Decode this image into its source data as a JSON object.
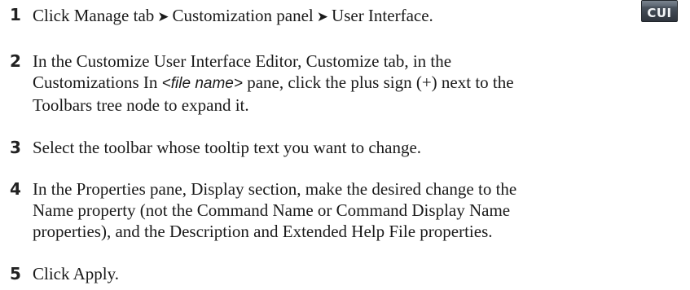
{
  "icon": {
    "name": "cui-icon",
    "label": "CUI"
  },
  "steps": [
    {
      "number": "1",
      "text_parts": [
        "Click Manage tab",
        "Customization panel",
        "User Interface."
      ],
      "arrow": "➤"
    },
    {
      "number": "2",
      "lines": [
        "In the Customize User Interface Editor, Customize tab, in the",
        "Customizations In ",
        "<file name>",
        " pane, click the plus sign (+) next to the",
        "Toolbars tree node to expand it."
      ]
    },
    {
      "number": "3",
      "text": "Select the toolbar whose tooltip text you want to change."
    },
    {
      "number": "4",
      "lines": [
        "In the Properties pane, Display section, make the desired change to the",
        "Name property (not the Command Name or Command Display Name",
        "properties), and the Description and Extended Help File properties."
      ]
    },
    {
      "number": "5",
      "text": "Click Apply."
    }
  ]
}
